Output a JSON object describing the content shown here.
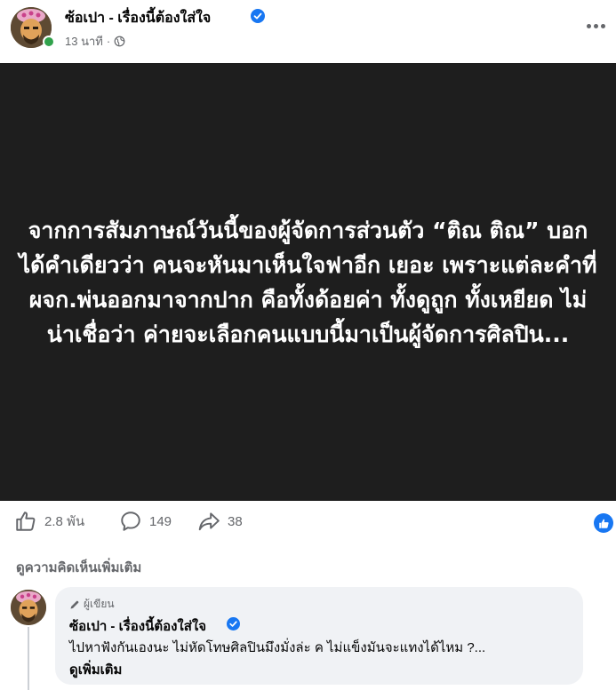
{
  "post": {
    "author_name": "ซ้อเปา - เรื่องนี้ต้องใส่ใจ",
    "time": "13 นาที",
    "meta_separator": "·",
    "image_text": "จากการสัมภาษณ์วันนี้ของผู้จัดการส่วนตัว “ติณ ติณ” บอกได้คำเดียวว่า คนจะหันมาเห็นใจฟาอีก เยอะ เพราะแต่ละคำที่ ผจก.พ่นออกมาจากปาก คือทั้งด้อยค่า ทั้งดูถูก ทั้งเหยียด ไม่น่าเชื่อว่า ค่ายจะเลือกคนแบบนี้มาเป็นผู้จัดการศิลปิน..."
  },
  "actions": {
    "likes": "2.8 พัน",
    "comments": "149",
    "shares": "38"
  },
  "comments_section": {
    "view_more_label": "ดูความคิดเห็นเพิ่มเติม",
    "comment": {
      "badge_label": "ผู้เขียน",
      "author_name": "ซ้อเปา - เรื่องนี้ต้องใส่ใจ",
      "text": "ไปหาฟังกันเองนะ ไม่หัดโทษศิลปินมึงมั่งล่ะ ค ไม่แข็งมันจะแทงได้ไหม ?...",
      "see_more_label": "ดูเพิ่มเติม"
    }
  },
  "colors": {
    "brand_blue": "#1877f2",
    "online_green": "#31a24c",
    "image_background": "#1e1e1e",
    "secondary_text": "#65676b",
    "comment_bubble": "#f0f2f5"
  },
  "icons": [
    "verified-badge-icon",
    "globe-icon",
    "more-options-icon",
    "like-thumb-icon",
    "comment-icon",
    "share-icon",
    "pencil-icon"
  ]
}
